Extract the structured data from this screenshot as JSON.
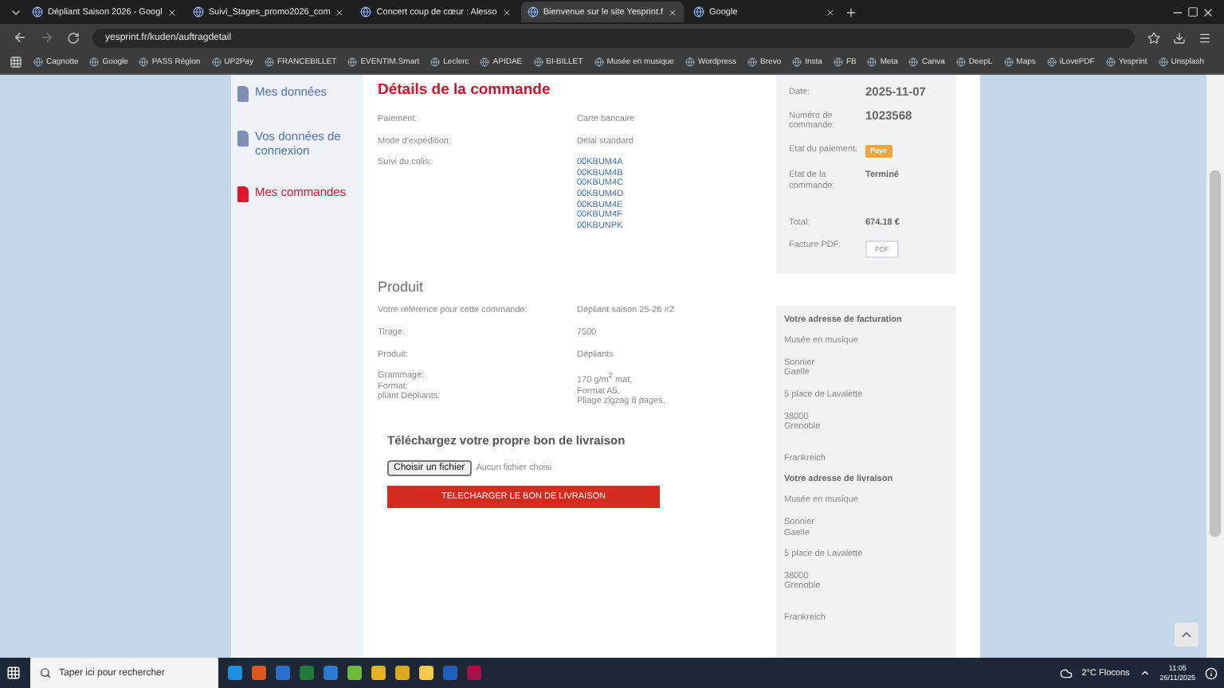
{
  "browser": {
    "tabs": [
      {
        "title": "Dépliant Saison 2026 - Googl",
        "selected": false
      },
      {
        "title": "Suivi_Stages_promo2026_com",
        "selected": false
      },
      {
        "title": "Concert coup de cœur : Alesso",
        "selected": false
      },
      {
        "title": "Bienvenue sur le site Yesprint.f",
        "selected": true
      },
      {
        "title": "Google",
        "selected": false
      }
    ],
    "url": "yesprint.fr/kuden/auftragdetail",
    "bookmarks": [
      "Cagnotte",
      "Google",
      "PASS Région",
      "UP2Pay",
      "FRANCEBILLET",
      "EVENTIM.Smart",
      "Leclerc",
      "APIDAE",
      "BI-BILLET",
      "Musée en musique",
      "Wordpress",
      "Brevo",
      "Insta",
      "FB",
      "Meta",
      "Canva",
      "DeepL",
      "Maps",
      "iLovePDF",
      "Yesprint",
      "Unsplash"
    ]
  },
  "sidebar": {
    "items": [
      {
        "label": "Mes données",
        "selected": false
      },
      {
        "label": "Vos données de connexion",
        "selected": false
      },
      {
        "label": "Mes commandes",
        "selected": true
      }
    ]
  },
  "order": {
    "title": "Détails de la commande",
    "fields": [
      {
        "label": "Paiement:",
        "value": "Carte bancaire"
      },
      {
        "label": "Mode d'expédition:",
        "value": "Délai standard"
      }
    ],
    "tracking": {
      "label": "Suivi du colis:",
      "codes": [
        "00KBUM4A",
        "00KBUM4B",
        "00KBUM4C",
        "00KBUM4D",
        "00KBUM4E",
        "00KBUM4F",
        "00KBUNPK"
      ]
    }
  },
  "product": {
    "title": "Produit",
    "rows": [
      {
        "labels": [
          "Votre référence pour cette commande:"
        ],
        "values": [
          "Dépliant saison 25-26 #2"
        ]
      },
      {
        "labels": [
          "Tirage:"
        ],
        "values": [
          "7500"
        ]
      },
      {
        "labels": [
          "Produit:"
        ],
        "values": [
          "Dépliants"
        ]
      },
      {
        "labels": [
          "Grammage:",
          "Format:",
          "pliant Dépliants:"
        ],
        "values": [
          "170 g/m$^{2}$ mat,",
          "Format A5,",
          "Pliage zigzag 8 pages,"
        ]
      }
    ]
  },
  "upload": {
    "title": "Téléchargez votre propre bon de livraison",
    "file_button": "Choisir un fichier",
    "file_status": "Aucun fichier choisi",
    "submit": "TELECHARGER LE BON DE LIVRAISON"
  },
  "summary": {
    "rows": [
      {
        "kind": "large",
        "label": "Date:",
        "value": "2025-11-07"
      },
      {
        "kind": "large",
        "label": "Numéro de commande:",
        "value": "1023568"
      },
      {
        "kind": "badge",
        "label": "Etat du paiement:",
        "value": "Payé"
      },
      {
        "kind": "text",
        "label": "Etat de la commande:",
        "value": "Terminé"
      },
      {
        "kind": "text",
        "label": "Total:",
        "value": "674.18 €"
      },
      {
        "kind": "button",
        "label": "Facture PDF:",
        "value": "PDF"
      }
    ]
  },
  "addresses": [
    {
      "title": "Votre adresse de facturation",
      "blocks": [
        [
          "Musée en musique"
        ],
        [
          "Sonnier",
          "Gaelle"
        ],
        [
          "5 place de Lavalette"
        ],
        [
          "38000",
          "Grenoble"
        ],
        [
          "Frankreich"
        ]
      ]
    },
    {
      "title": "Votre adresse de livraison",
      "blocks": [
        [
          "Musée en musique"
        ],
        [
          "Sonnier",
          "Gaelle"
        ],
        [
          "5 place de Lavalette"
        ],
        [
          "38000",
          "Grenoble"
        ],
        [
          "Frankreich"
        ]
      ]
    }
  ],
  "taskbar": {
    "search_placeholder": "Taper ici pour rechercher",
    "weather": "2°C  Flocons",
    "time": "11:05",
    "date": "26/11/2025"
  }
}
